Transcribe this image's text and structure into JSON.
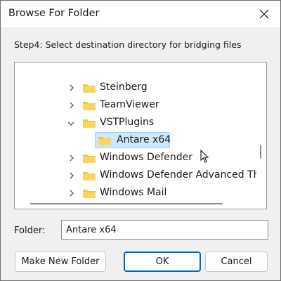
{
  "window": {
    "title": "Browse For Folder",
    "close_icon": "close-icon"
  },
  "instruction": "Step4: Select destination directory for bridging files",
  "tree": {
    "items": [
      {
        "label": "Steinberg",
        "expanded": false,
        "level": 1
      },
      {
        "label": "TeamViewer",
        "expanded": false,
        "level": 1
      },
      {
        "label": "VSTPlugins",
        "expanded": true,
        "level": 1
      },
      {
        "label": "Antare x64",
        "level": 2,
        "selected": true
      },
      {
        "label": "Windows Defender",
        "expanded": false,
        "level": 1
      },
      {
        "label": "Windows Defender Advanced Th",
        "expanded": false,
        "level": 1
      },
      {
        "label": "Windows Mail",
        "expanded": false,
        "level": 1
      }
    ]
  },
  "folder_field": {
    "label": "Folder:",
    "value": "Antare x64"
  },
  "buttons": {
    "make_new_folder": "Make New Folder",
    "ok": "OK",
    "cancel": "Cancel"
  },
  "colors": {
    "selection": "#cce8ff",
    "folder": "#f8c440",
    "accent": "#0067c0"
  }
}
